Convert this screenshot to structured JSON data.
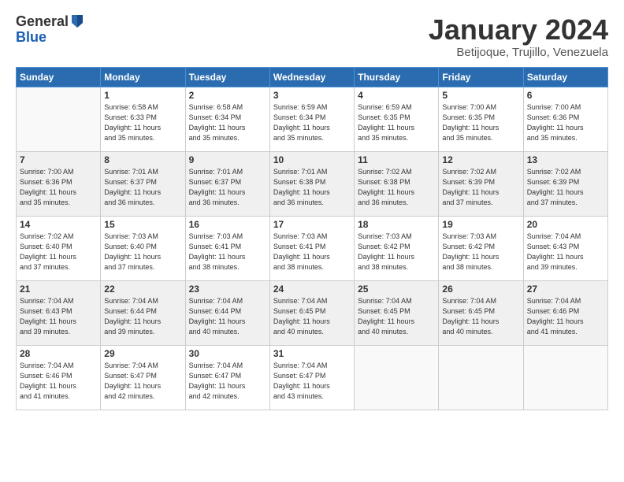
{
  "logo": {
    "general": "General",
    "blue": "Blue"
  },
  "title": "January 2024",
  "subtitle": "Betijoque, Trujillo, Venezuela",
  "days_header": [
    "Sunday",
    "Monday",
    "Tuesday",
    "Wednesday",
    "Thursday",
    "Friday",
    "Saturday"
  ],
  "weeks": [
    {
      "shade": "white",
      "days": [
        {
          "num": "",
          "empty": true
        },
        {
          "num": "1",
          "sunrise": "Sunrise: 6:58 AM",
          "sunset": "Sunset: 6:33 PM",
          "daylight": "Daylight: 11 hours and 35 minutes."
        },
        {
          "num": "2",
          "sunrise": "Sunrise: 6:58 AM",
          "sunset": "Sunset: 6:34 PM",
          "daylight": "Daylight: 11 hours and 35 minutes."
        },
        {
          "num": "3",
          "sunrise": "Sunrise: 6:59 AM",
          "sunset": "Sunset: 6:34 PM",
          "daylight": "Daylight: 11 hours and 35 minutes."
        },
        {
          "num": "4",
          "sunrise": "Sunrise: 6:59 AM",
          "sunset": "Sunset: 6:35 PM",
          "daylight": "Daylight: 11 hours and 35 minutes."
        },
        {
          "num": "5",
          "sunrise": "Sunrise: 7:00 AM",
          "sunset": "Sunset: 6:35 PM",
          "daylight": "Daylight: 11 hours and 35 minutes."
        },
        {
          "num": "6",
          "sunrise": "Sunrise: 7:00 AM",
          "sunset": "Sunset: 6:36 PM",
          "daylight": "Daylight: 11 hours and 35 minutes."
        }
      ]
    },
    {
      "shade": "shaded",
      "days": [
        {
          "num": "7",
          "sunrise": "Sunrise: 7:00 AM",
          "sunset": "Sunset: 6:36 PM",
          "daylight": "Daylight: 11 hours and 35 minutes."
        },
        {
          "num": "8",
          "sunrise": "Sunrise: 7:01 AM",
          "sunset": "Sunset: 6:37 PM",
          "daylight": "Daylight: 11 hours and 36 minutes."
        },
        {
          "num": "9",
          "sunrise": "Sunrise: 7:01 AM",
          "sunset": "Sunset: 6:37 PM",
          "daylight": "Daylight: 11 hours and 36 minutes."
        },
        {
          "num": "10",
          "sunrise": "Sunrise: 7:01 AM",
          "sunset": "Sunset: 6:38 PM",
          "daylight": "Daylight: 11 hours and 36 minutes."
        },
        {
          "num": "11",
          "sunrise": "Sunrise: 7:02 AM",
          "sunset": "Sunset: 6:38 PM",
          "daylight": "Daylight: 11 hours and 36 minutes."
        },
        {
          "num": "12",
          "sunrise": "Sunrise: 7:02 AM",
          "sunset": "Sunset: 6:39 PM",
          "daylight": "Daylight: 11 hours and 37 minutes."
        },
        {
          "num": "13",
          "sunrise": "Sunrise: 7:02 AM",
          "sunset": "Sunset: 6:39 PM",
          "daylight": "Daylight: 11 hours and 37 minutes."
        }
      ]
    },
    {
      "shade": "white",
      "days": [
        {
          "num": "14",
          "sunrise": "Sunrise: 7:02 AM",
          "sunset": "Sunset: 6:40 PM",
          "daylight": "Daylight: 11 hours and 37 minutes."
        },
        {
          "num": "15",
          "sunrise": "Sunrise: 7:03 AM",
          "sunset": "Sunset: 6:40 PM",
          "daylight": "Daylight: 11 hours and 37 minutes."
        },
        {
          "num": "16",
          "sunrise": "Sunrise: 7:03 AM",
          "sunset": "Sunset: 6:41 PM",
          "daylight": "Daylight: 11 hours and 38 minutes."
        },
        {
          "num": "17",
          "sunrise": "Sunrise: 7:03 AM",
          "sunset": "Sunset: 6:41 PM",
          "daylight": "Daylight: 11 hours and 38 minutes."
        },
        {
          "num": "18",
          "sunrise": "Sunrise: 7:03 AM",
          "sunset": "Sunset: 6:42 PM",
          "daylight": "Daylight: 11 hours and 38 minutes."
        },
        {
          "num": "19",
          "sunrise": "Sunrise: 7:03 AM",
          "sunset": "Sunset: 6:42 PM",
          "daylight": "Daylight: 11 hours and 38 minutes."
        },
        {
          "num": "20",
          "sunrise": "Sunrise: 7:04 AM",
          "sunset": "Sunset: 6:43 PM",
          "daylight": "Daylight: 11 hours and 39 minutes."
        }
      ]
    },
    {
      "shade": "shaded",
      "days": [
        {
          "num": "21",
          "sunrise": "Sunrise: 7:04 AM",
          "sunset": "Sunset: 6:43 PM",
          "daylight": "Daylight: 11 hours and 39 minutes."
        },
        {
          "num": "22",
          "sunrise": "Sunrise: 7:04 AM",
          "sunset": "Sunset: 6:44 PM",
          "daylight": "Daylight: 11 hours and 39 minutes."
        },
        {
          "num": "23",
          "sunrise": "Sunrise: 7:04 AM",
          "sunset": "Sunset: 6:44 PM",
          "daylight": "Daylight: 11 hours and 40 minutes."
        },
        {
          "num": "24",
          "sunrise": "Sunrise: 7:04 AM",
          "sunset": "Sunset: 6:45 PM",
          "daylight": "Daylight: 11 hours and 40 minutes."
        },
        {
          "num": "25",
          "sunrise": "Sunrise: 7:04 AM",
          "sunset": "Sunset: 6:45 PM",
          "daylight": "Daylight: 11 hours and 40 minutes."
        },
        {
          "num": "26",
          "sunrise": "Sunrise: 7:04 AM",
          "sunset": "Sunset: 6:45 PM",
          "daylight": "Daylight: 11 hours and 40 minutes."
        },
        {
          "num": "27",
          "sunrise": "Sunrise: 7:04 AM",
          "sunset": "Sunset: 6:46 PM",
          "daylight": "Daylight: 11 hours and 41 minutes."
        }
      ]
    },
    {
      "shade": "white",
      "days": [
        {
          "num": "28",
          "sunrise": "Sunrise: 7:04 AM",
          "sunset": "Sunset: 6:46 PM",
          "daylight": "Daylight: 11 hours and 41 minutes."
        },
        {
          "num": "29",
          "sunrise": "Sunrise: 7:04 AM",
          "sunset": "Sunset: 6:47 PM",
          "daylight": "Daylight: 11 hours and 42 minutes."
        },
        {
          "num": "30",
          "sunrise": "Sunrise: 7:04 AM",
          "sunset": "Sunset: 6:47 PM",
          "daylight": "Daylight: 11 hours and 42 minutes."
        },
        {
          "num": "31",
          "sunrise": "Sunrise: 7:04 AM",
          "sunset": "Sunset: 6:47 PM",
          "daylight": "Daylight: 11 hours and 43 minutes."
        },
        {
          "num": "",
          "empty": true
        },
        {
          "num": "",
          "empty": true
        },
        {
          "num": "",
          "empty": true
        }
      ]
    }
  ]
}
